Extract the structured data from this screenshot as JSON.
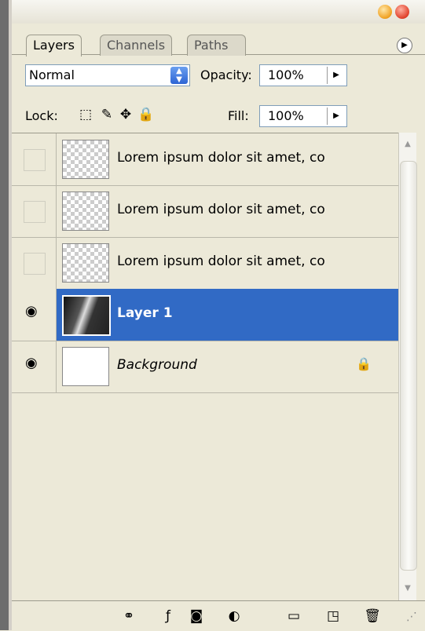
{
  "tabs": [
    {
      "label": "Layers"
    },
    {
      "label": "Channels"
    },
    {
      "label": "Paths"
    }
  ],
  "panel_menu_icon": "flyout-menu-icon",
  "blend_mode": {
    "value": "Normal"
  },
  "opacity": {
    "label": "Opacity:",
    "value": "100%"
  },
  "lock": {
    "label": "Lock:",
    "icons": [
      "lock-transparent-pixels-icon",
      "lock-image-pixels-icon",
      "lock-position-icon",
      "lock-all-icon"
    ]
  },
  "fill": {
    "label": "Fill:",
    "value": "100%"
  },
  "layers": [
    {
      "name": "Lorem ipsum dolor sit amet, co",
      "visible": false,
      "thumb": "transparent"
    },
    {
      "name": "Lorem ipsum dolor sit amet, co",
      "visible": false,
      "thumb": "transparent"
    },
    {
      "name": "Lorem ipsum dolor sit amet, co",
      "visible": false,
      "thumb": "transparent"
    },
    {
      "name": "Layer 1",
      "visible": true,
      "thumb": "photo",
      "selected": true
    },
    {
      "name": "Background",
      "visible": true,
      "thumb": "white",
      "locked": true,
      "italic": true
    }
  ],
  "bottom_icons": [
    "link-layers-icon",
    "layer-style-icon",
    "layer-mask-icon",
    "adjustment-layer-icon",
    "new-group-icon",
    "new-layer-icon",
    "delete-layer-icon"
  ],
  "colors": {
    "selected_row": "#316ac5",
    "panel_bg": "#ece9d8"
  }
}
